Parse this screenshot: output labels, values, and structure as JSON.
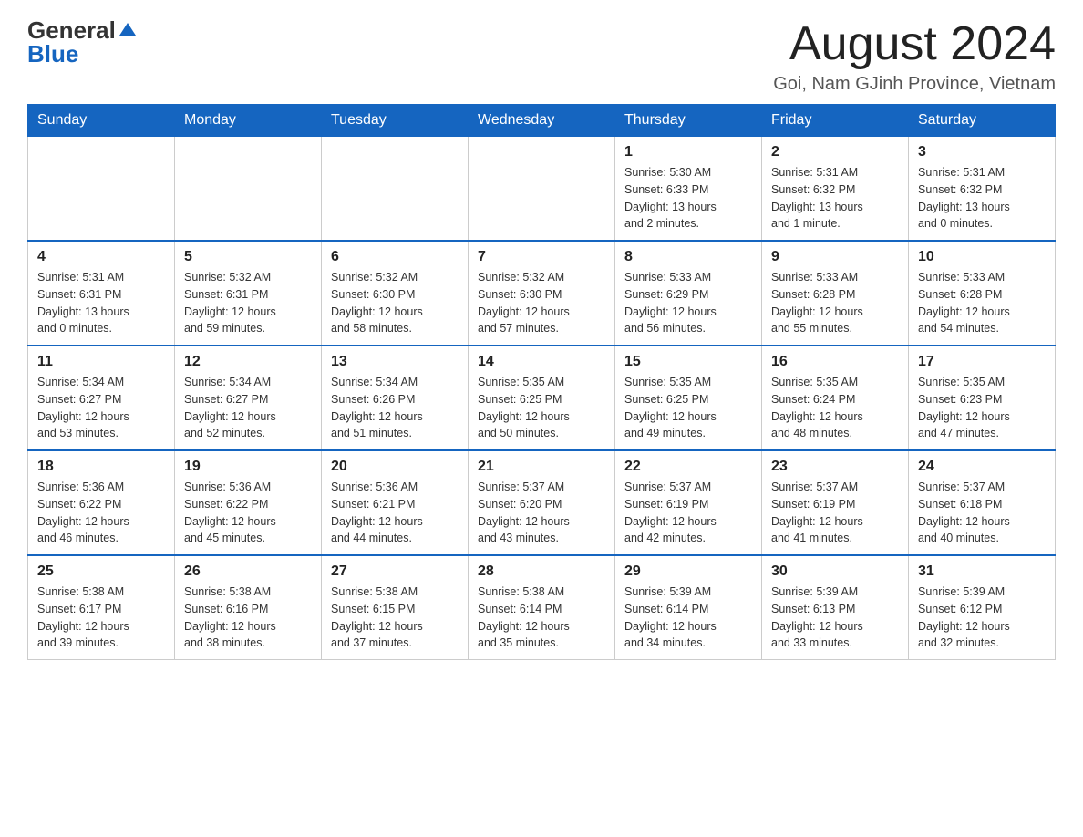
{
  "header": {
    "logo_general": "General",
    "logo_blue": "Blue",
    "month_title": "August 2024",
    "location": "Goi, Nam GJinh Province, Vietnam"
  },
  "days_of_week": [
    "Sunday",
    "Monday",
    "Tuesday",
    "Wednesday",
    "Thursday",
    "Friday",
    "Saturday"
  ],
  "weeks": [
    [
      {
        "day": "",
        "info": ""
      },
      {
        "day": "",
        "info": ""
      },
      {
        "day": "",
        "info": ""
      },
      {
        "day": "",
        "info": ""
      },
      {
        "day": "1",
        "info": "Sunrise: 5:30 AM\nSunset: 6:33 PM\nDaylight: 13 hours\nand 2 minutes."
      },
      {
        "day": "2",
        "info": "Sunrise: 5:31 AM\nSunset: 6:32 PM\nDaylight: 13 hours\nand 1 minute."
      },
      {
        "day": "3",
        "info": "Sunrise: 5:31 AM\nSunset: 6:32 PM\nDaylight: 13 hours\nand 0 minutes."
      }
    ],
    [
      {
        "day": "4",
        "info": "Sunrise: 5:31 AM\nSunset: 6:31 PM\nDaylight: 13 hours\nand 0 minutes."
      },
      {
        "day": "5",
        "info": "Sunrise: 5:32 AM\nSunset: 6:31 PM\nDaylight: 12 hours\nand 59 minutes."
      },
      {
        "day": "6",
        "info": "Sunrise: 5:32 AM\nSunset: 6:30 PM\nDaylight: 12 hours\nand 58 minutes."
      },
      {
        "day": "7",
        "info": "Sunrise: 5:32 AM\nSunset: 6:30 PM\nDaylight: 12 hours\nand 57 minutes."
      },
      {
        "day": "8",
        "info": "Sunrise: 5:33 AM\nSunset: 6:29 PM\nDaylight: 12 hours\nand 56 minutes."
      },
      {
        "day": "9",
        "info": "Sunrise: 5:33 AM\nSunset: 6:28 PM\nDaylight: 12 hours\nand 55 minutes."
      },
      {
        "day": "10",
        "info": "Sunrise: 5:33 AM\nSunset: 6:28 PM\nDaylight: 12 hours\nand 54 minutes."
      }
    ],
    [
      {
        "day": "11",
        "info": "Sunrise: 5:34 AM\nSunset: 6:27 PM\nDaylight: 12 hours\nand 53 minutes."
      },
      {
        "day": "12",
        "info": "Sunrise: 5:34 AM\nSunset: 6:27 PM\nDaylight: 12 hours\nand 52 minutes."
      },
      {
        "day": "13",
        "info": "Sunrise: 5:34 AM\nSunset: 6:26 PM\nDaylight: 12 hours\nand 51 minutes."
      },
      {
        "day": "14",
        "info": "Sunrise: 5:35 AM\nSunset: 6:25 PM\nDaylight: 12 hours\nand 50 minutes."
      },
      {
        "day": "15",
        "info": "Sunrise: 5:35 AM\nSunset: 6:25 PM\nDaylight: 12 hours\nand 49 minutes."
      },
      {
        "day": "16",
        "info": "Sunrise: 5:35 AM\nSunset: 6:24 PM\nDaylight: 12 hours\nand 48 minutes."
      },
      {
        "day": "17",
        "info": "Sunrise: 5:35 AM\nSunset: 6:23 PM\nDaylight: 12 hours\nand 47 minutes."
      }
    ],
    [
      {
        "day": "18",
        "info": "Sunrise: 5:36 AM\nSunset: 6:22 PM\nDaylight: 12 hours\nand 46 minutes."
      },
      {
        "day": "19",
        "info": "Sunrise: 5:36 AM\nSunset: 6:22 PM\nDaylight: 12 hours\nand 45 minutes."
      },
      {
        "day": "20",
        "info": "Sunrise: 5:36 AM\nSunset: 6:21 PM\nDaylight: 12 hours\nand 44 minutes."
      },
      {
        "day": "21",
        "info": "Sunrise: 5:37 AM\nSunset: 6:20 PM\nDaylight: 12 hours\nand 43 minutes."
      },
      {
        "day": "22",
        "info": "Sunrise: 5:37 AM\nSunset: 6:19 PM\nDaylight: 12 hours\nand 42 minutes."
      },
      {
        "day": "23",
        "info": "Sunrise: 5:37 AM\nSunset: 6:19 PM\nDaylight: 12 hours\nand 41 minutes."
      },
      {
        "day": "24",
        "info": "Sunrise: 5:37 AM\nSunset: 6:18 PM\nDaylight: 12 hours\nand 40 minutes."
      }
    ],
    [
      {
        "day": "25",
        "info": "Sunrise: 5:38 AM\nSunset: 6:17 PM\nDaylight: 12 hours\nand 39 minutes."
      },
      {
        "day": "26",
        "info": "Sunrise: 5:38 AM\nSunset: 6:16 PM\nDaylight: 12 hours\nand 38 minutes."
      },
      {
        "day": "27",
        "info": "Sunrise: 5:38 AM\nSunset: 6:15 PM\nDaylight: 12 hours\nand 37 minutes."
      },
      {
        "day": "28",
        "info": "Sunrise: 5:38 AM\nSunset: 6:14 PM\nDaylight: 12 hours\nand 35 minutes."
      },
      {
        "day": "29",
        "info": "Sunrise: 5:39 AM\nSunset: 6:14 PM\nDaylight: 12 hours\nand 34 minutes."
      },
      {
        "day": "30",
        "info": "Sunrise: 5:39 AM\nSunset: 6:13 PM\nDaylight: 12 hours\nand 33 minutes."
      },
      {
        "day": "31",
        "info": "Sunrise: 5:39 AM\nSunset: 6:12 PM\nDaylight: 12 hours\nand 32 minutes."
      }
    ]
  ]
}
